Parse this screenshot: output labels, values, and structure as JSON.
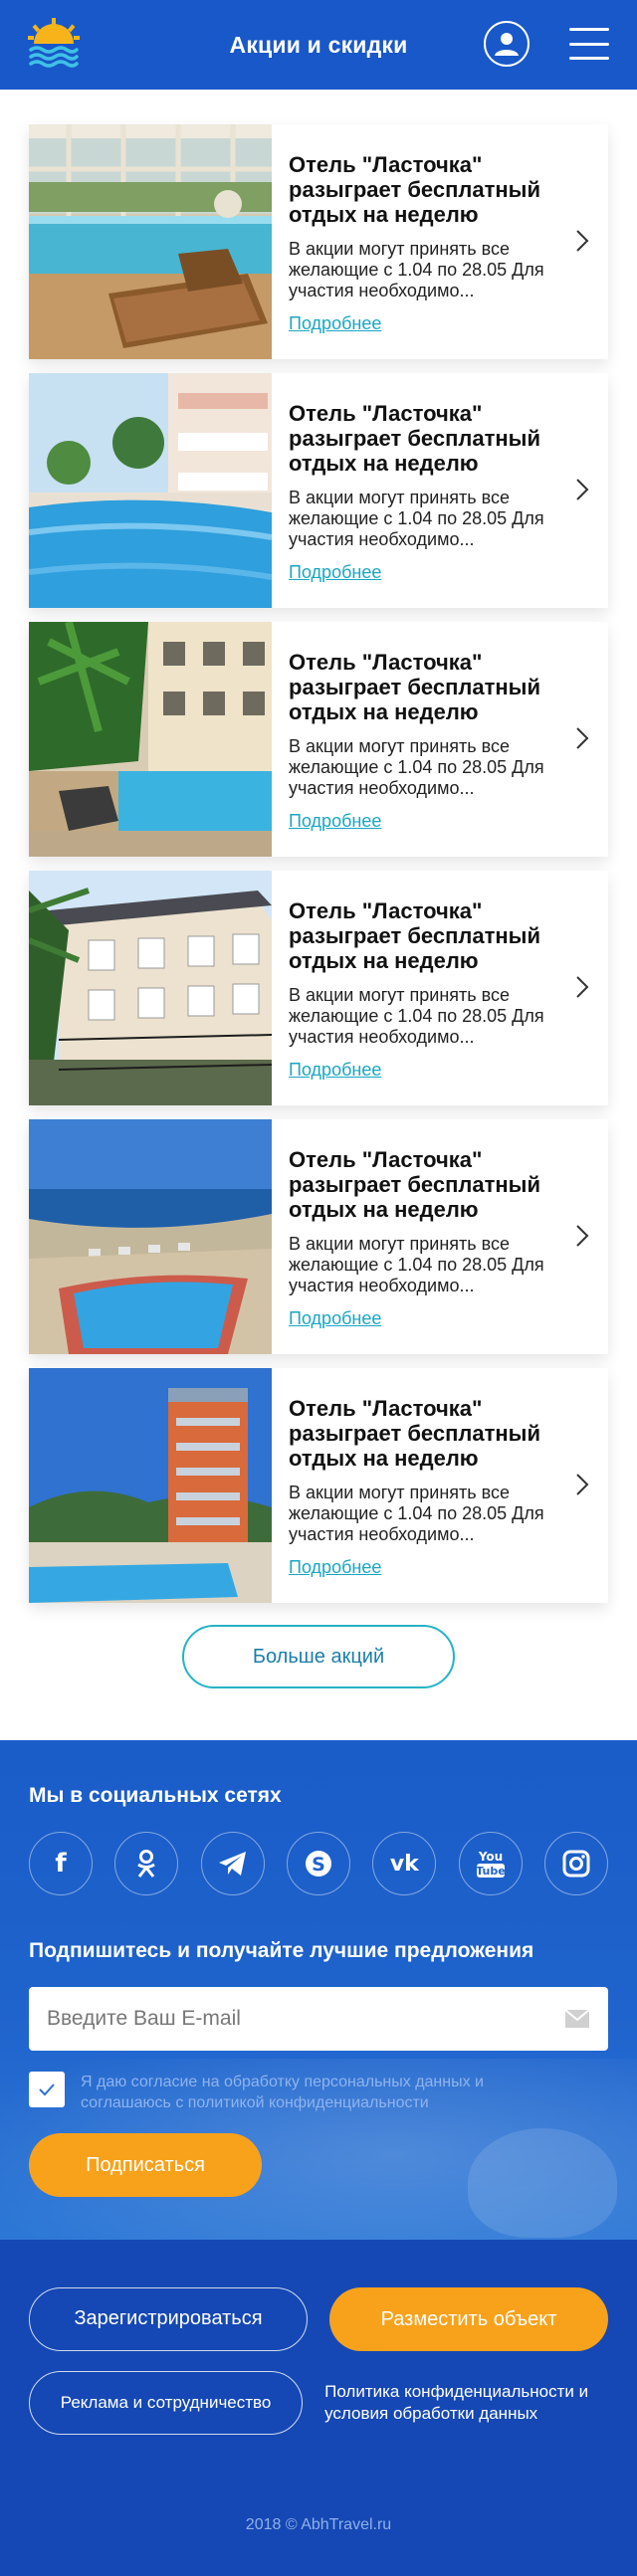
{
  "header": {
    "title": "Акции и скидки"
  },
  "promos": [
    {
      "title": "Отель \"Ласточка\" разыгрaет бесплатный отдых на неделю",
      "text": "В акции могут принять все желающие с 1.04 по 28.05 Для участия необходимо...",
      "more": "Подробнее"
    },
    {
      "title": "Отель \"Ласточка\" разыгрaет бесплатный отдых на неделю",
      "text": "В акции могут принять все желающие с 1.04 по 28.05 Для участия необходимо...",
      "more": "Подробнее"
    },
    {
      "title": "Отель \"Ласточка\" разыгрaет бесплатный отдых на неделю",
      "text": "В акции могут принять все желающие с 1.04 по 28.05 Для участия необходимо...",
      "more": "Подробнее"
    },
    {
      "title": "Отель \"Ласточка\" разыгрaет бесплатный отдых на неделю",
      "text": "В акции могут принять все желающие с 1.04 по 28.05 Для участия необходимо...",
      "more": "Подробнее"
    },
    {
      "title": "Отель \"Ласточка\" разыгрaет бесплатный отдых на неделю",
      "text": "В акции могут принять все желающие с 1.04 по 28.05 Для участия необходимо...",
      "more": "Подробнее"
    },
    {
      "title": "Отель \"Ласточка\" разыгрaет бесплатный отдых на неделю",
      "text": "В акции могут принять все желающие с 1.04 по 28.05 Для участия необходимо...",
      "more": "Подробнее"
    }
  ],
  "more_button": "Больше акций",
  "social": {
    "title": "Мы в социальных сетях",
    "networks": [
      "facebook",
      "odnoklassniki",
      "telegram",
      "skype",
      "vk",
      "youtube",
      "instagram"
    ]
  },
  "subscribe": {
    "title": "Подпишитесь и получайте лучшие предложения",
    "placeholder": "Введите Ваш E-mail",
    "agreement": "Я даю согласие на обработку персональных данных и соглашаюсь с политикой конфиденциальности",
    "button": "Подписаться"
  },
  "footer": {
    "register": "Зарегистрироваться",
    "place_object": "Разместить объект",
    "ads": "Реклама и сотрудничество",
    "policy": "Политика конфиденциальности и условия обработки данных",
    "copyright": "2018 © AbhTravel.ru"
  },
  "colors": {
    "brand_blue": "#1958c9",
    "accent_orange": "#f8a21b",
    "link_teal": "#1aa6c2"
  }
}
